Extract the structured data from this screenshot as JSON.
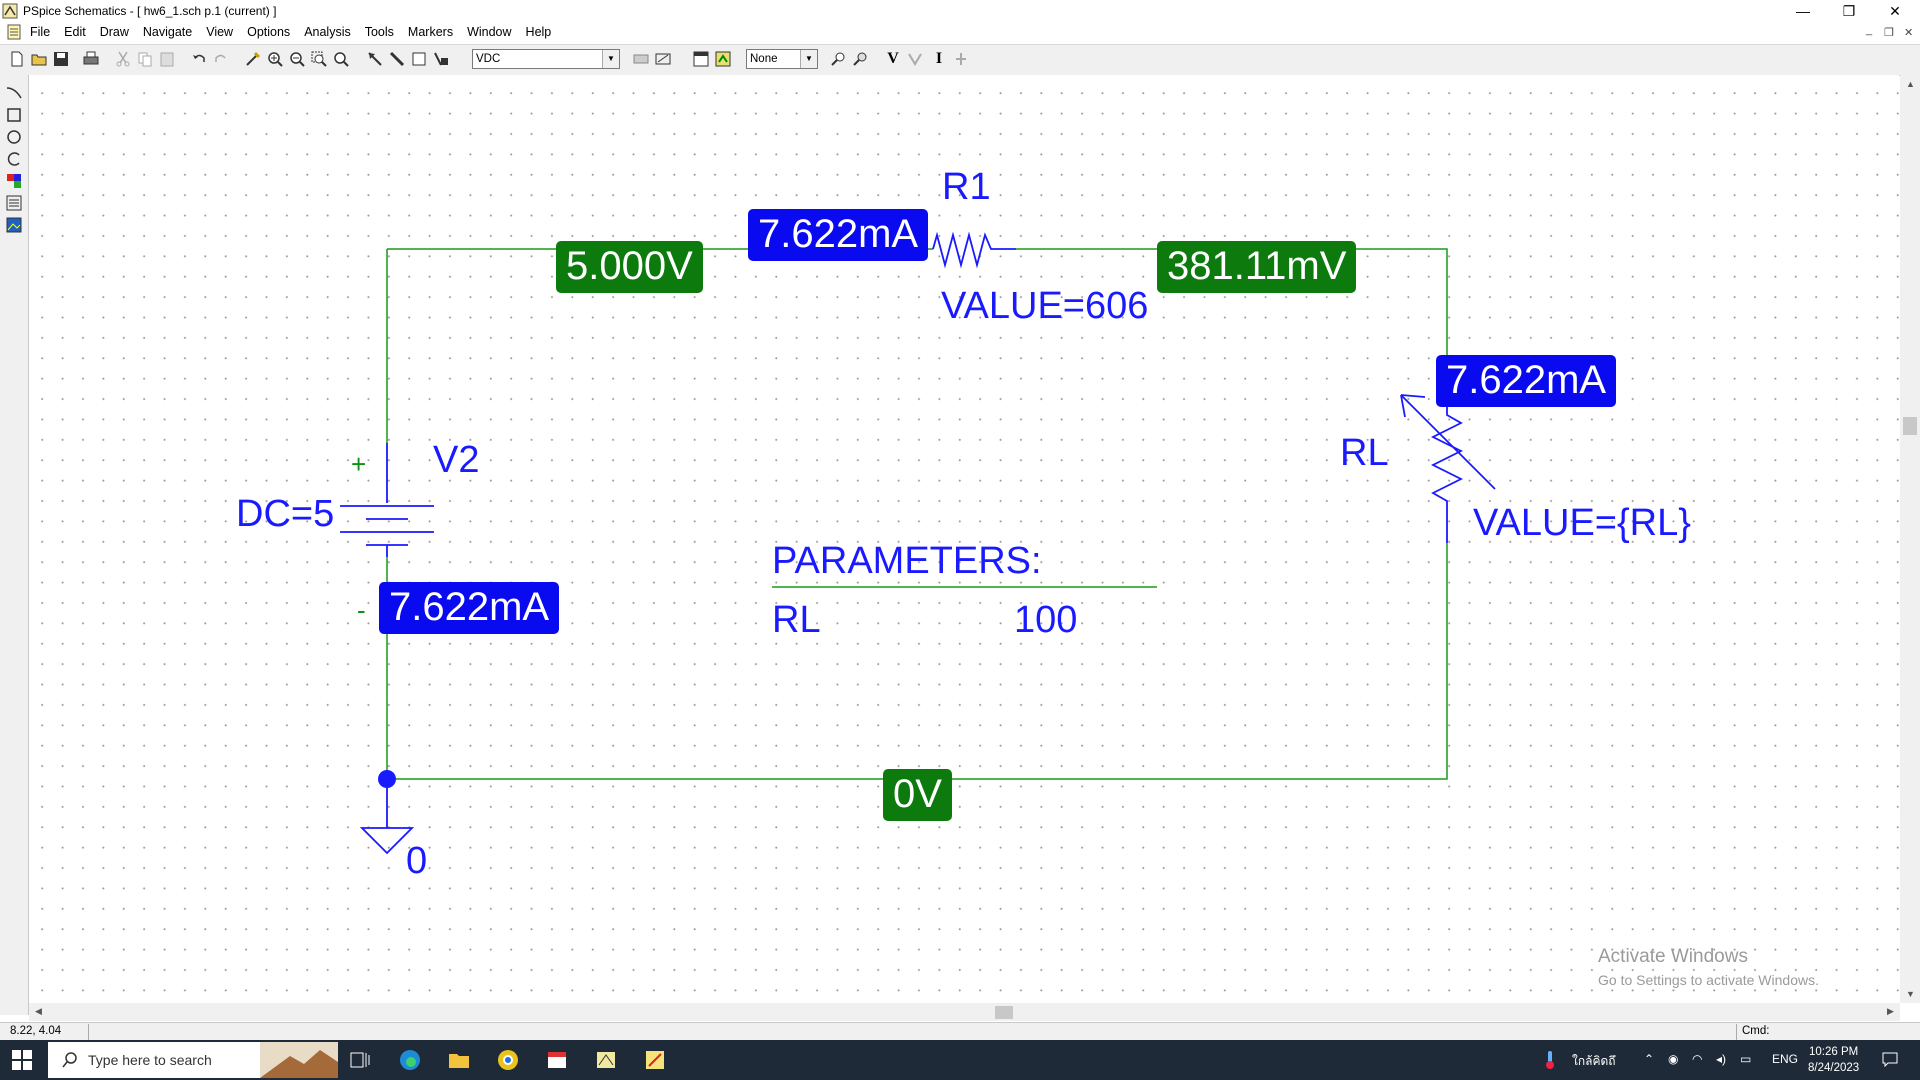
{
  "window": {
    "title": "PSpice Schematics - [ hw6_1.sch  p.1 (current) ]",
    "minimize_glyph": "—",
    "restore_glyph": "❐",
    "close_glyph": "✕",
    "mdi_min": "_",
    "mdi_restore": "❐",
    "mdi_close": "✕"
  },
  "menu": [
    "File",
    "Edit",
    "Draw",
    "Navigate",
    "View",
    "Options",
    "Analysis",
    "Tools",
    "Markers",
    "Window",
    "Help"
  ],
  "toolbar": {
    "part_combo": "VDC",
    "marker_combo": "None",
    "v_label": "V",
    "i_label": "I"
  },
  "schematic": {
    "r1_name": "R1",
    "r1_value": "VALUE=606",
    "rl_name": "RL",
    "rl_value": "VALUE={RL}",
    "v2_name": "V2",
    "v2_value": "DC=5",
    "plus_sign": "+",
    "minus_sign": "-",
    "ground_label": "0",
    "parameters_title": "PARAMETERS:",
    "param_name": "RL",
    "param_value": "100",
    "markers": {
      "current_r1": "7.622mA",
      "current_rl": "7.622mA",
      "current_v2": "7.622mA",
      "voltage_top_left": "5.000V",
      "voltage_top_right": "381.11mV",
      "voltage_ground": "0V"
    },
    "colors": {
      "wire": "#1a9a1a",
      "part": "#1a1aff",
      "current_badge": "#0a0af0",
      "voltage_badge": "#0d7a0d"
    }
  },
  "status": {
    "coords": "8.22,  4.04",
    "cmd": "Cmd:"
  },
  "watermark": {
    "line1": "Activate Windows",
    "line2": "Go to Settings to activate Windows."
  },
  "taskbar": {
    "search_placeholder": "Type here to search",
    "weather": "ใกล้คิดถึ",
    "lang": "ENG",
    "time": "10:26 PM",
    "date": "8/24/2023"
  }
}
